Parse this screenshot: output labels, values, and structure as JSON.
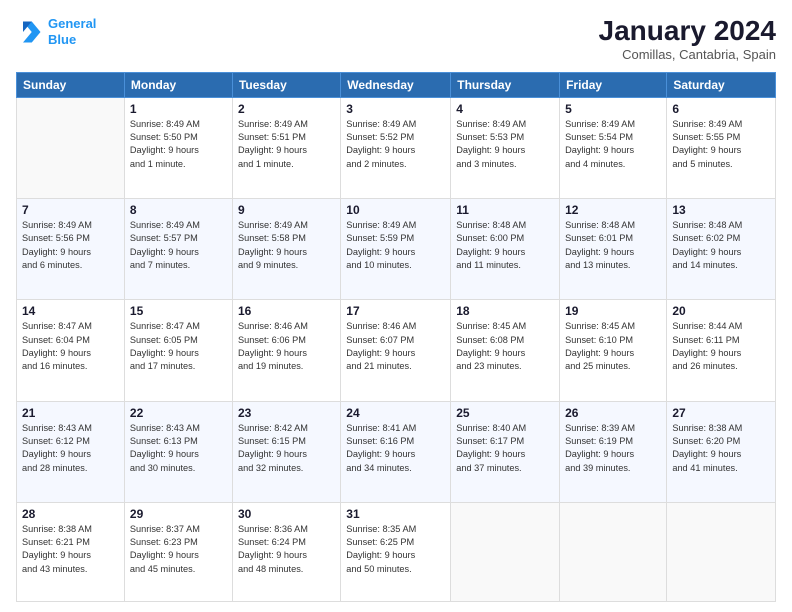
{
  "header": {
    "logo_line1": "General",
    "logo_line2": "Blue",
    "month": "January 2024",
    "location": "Comillas, Cantabria, Spain"
  },
  "weekdays": [
    "Sunday",
    "Monday",
    "Tuesday",
    "Wednesday",
    "Thursday",
    "Friday",
    "Saturday"
  ],
  "weeks": [
    [
      {
        "day": "",
        "sunrise": "",
        "sunset": "",
        "daylight": ""
      },
      {
        "day": "1",
        "sunrise": "Sunrise: 8:49 AM",
        "sunset": "Sunset: 5:50 PM",
        "daylight": "Daylight: 9 hours and 1 minute."
      },
      {
        "day": "2",
        "sunrise": "Sunrise: 8:49 AM",
        "sunset": "Sunset: 5:51 PM",
        "daylight": "Daylight: 9 hours and 1 minute."
      },
      {
        "day": "3",
        "sunrise": "Sunrise: 8:49 AM",
        "sunset": "Sunset: 5:52 PM",
        "daylight": "Daylight: 9 hours and 2 minutes."
      },
      {
        "day": "4",
        "sunrise": "Sunrise: 8:49 AM",
        "sunset": "Sunset: 5:53 PM",
        "daylight": "Daylight: 9 hours and 3 minutes."
      },
      {
        "day": "5",
        "sunrise": "Sunrise: 8:49 AM",
        "sunset": "Sunset: 5:54 PM",
        "daylight": "Daylight: 9 hours and 4 minutes."
      },
      {
        "day": "6",
        "sunrise": "Sunrise: 8:49 AM",
        "sunset": "Sunset: 5:55 PM",
        "daylight": "Daylight: 9 hours and 5 minutes."
      }
    ],
    [
      {
        "day": "7",
        "sunrise": "Sunrise: 8:49 AM",
        "sunset": "Sunset: 5:56 PM",
        "daylight": "Daylight: 9 hours and 6 minutes."
      },
      {
        "day": "8",
        "sunrise": "Sunrise: 8:49 AM",
        "sunset": "Sunset: 5:57 PM",
        "daylight": "Daylight: 9 hours and 7 minutes."
      },
      {
        "day": "9",
        "sunrise": "Sunrise: 8:49 AM",
        "sunset": "Sunset: 5:58 PM",
        "daylight": "Daylight: 9 hours and 9 minutes."
      },
      {
        "day": "10",
        "sunrise": "Sunrise: 8:49 AM",
        "sunset": "Sunset: 5:59 PM",
        "daylight": "Daylight: 9 hours and 10 minutes."
      },
      {
        "day": "11",
        "sunrise": "Sunrise: 8:48 AM",
        "sunset": "Sunset: 6:00 PM",
        "daylight": "Daylight: 9 hours and 11 minutes."
      },
      {
        "day": "12",
        "sunrise": "Sunrise: 8:48 AM",
        "sunset": "Sunset: 6:01 PM",
        "daylight": "Daylight: 9 hours and 13 minutes."
      },
      {
        "day": "13",
        "sunrise": "Sunrise: 8:48 AM",
        "sunset": "Sunset: 6:02 PM",
        "daylight": "Daylight: 9 hours and 14 minutes."
      }
    ],
    [
      {
        "day": "14",
        "sunrise": "Sunrise: 8:47 AM",
        "sunset": "Sunset: 6:04 PM",
        "daylight": "Daylight: 9 hours and 16 minutes."
      },
      {
        "day": "15",
        "sunrise": "Sunrise: 8:47 AM",
        "sunset": "Sunset: 6:05 PM",
        "daylight": "Daylight: 9 hours and 17 minutes."
      },
      {
        "day": "16",
        "sunrise": "Sunrise: 8:46 AM",
        "sunset": "Sunset: 6:06 PM",
        "daylight": "Daylight: 9 hours and 19 minutes."
      },
      {
        "day": "17",
        "sunrise": "Sunrise: 8:46 AM",
        "sunset": "Sunset: 6:07 PM",
        "daylight": "Daylight: 9 hours and 21 minutes."
      },
      {
        "day": "18",
        "sunrise": "Sunrise: 8:45 AM",
        "sunset": "Sunset: 6:08 PM",
        "daylight": "Daylight: 9 hours and 23 minutes."
      },
      {
        "day": "19",
        "sunrise": "Sunrise: 8:45 AM",
        "sunset": "Sunset: 6:10 PM",
        "daylight": "Daylight: 9 hours and 25 minutes."
      },
      {
        "day": "20",
        "sunrise": "Sunrise: 8:44 AM",
        "sunset": "Sunset: 6:11 PM",
        "daylight": "Daylight: 9 hours and 26 minutes."
      }
    ],
    [
      {
        "day": "21",
        "sunrise": "Sunrise: 8:43 AM",
        "sunset": "Sunset: 6:12 PM",
        "daylight": "Daylight: 9 hours and 28 minutes."
      },
      {
        "day": "22",
        "sunrise": "Sunrise: 8:43 AM",
        "sunset": "Sunset: 6:13 PM",
        "daylight": "Daylight: 9 hours and 30 minutes."
      },
      {
        "day": "23",
        "sunrise": "Sunrise: 8:42 AM",
        "sunset": "Sunset: 6:15 PM",
        "daylight": "Daylight: 9 hours and 32 minutes."
      },
      {
        "day": "24",
        "sunrise": "Sunrise: 8:41 AM",
        "sunset": "Sunset: 6:16 PM",
        "daylight": "Daylight: 9 hours and 34 minutes."
      },
      {
        "day": "25",
        "sunrise": "Sunrise: 8:40 AM",
        "sunset": "Sunset: 6:17 PM",
        "daylight": "Daylight: 9 hours and 37 minutes."
      },
      {
        "day": "26",
        "sunrise": "Sunrise: 8:39 AM",
        "sunset": "Sunset: 6:19 PM",
        "daylight": "Daylight: 9 hours and 39 minutes."
      },
      {
        "day": "27",
        "sunrise": "Sunrise: 8:38 AM",
        "sunset": "Sunset: 6:20 PM",
        "daylight": "Daylight: 9 hours and 41 minutes."
      }
    ],
    [
      {
        "day": "28",
        "sunrise": "Sunrise: 8:38 AM",
        "sunset": "Sunset: 6:21 PM",
        "daylight": "Daylight: 9 hours and 43 minutes."
      },
      {
        "day": "29",
        "sunrise": "Sunrise: 8:37 AM",
        "sunset": "Sunset: 6:23 PM",
        "daylight": "Daylight: 9 hours and 45 minutes."
      },
      {
        "day": "30",
        "sunrise": "Sunrise: 8:36 AM",
        "sunset": "Sunset: 6:24 PM",
        "daylight": "Daylight: 9 hours and 48 minutes."
      },
      {
        "day": "31",
        "sunrise": "Sunrise: 8:35 AM",
        "sunset": "Sunset: 6:25 PM",
        "daylight": "Daylight: 9 hours and 50 minutes."
      },
      {
        "day": "",
        "sunrise": "",
        "sunset": "",
        "daylight": ""
      },
      {
        "day": "",
        "sunrise": "",
        "sunset": "",
        "daylight": ""
      },
      {
        "day": "",
        "sunrise": "",
        "sunset": "",
        "daylight": ""
      }
    ]
  ]
}
